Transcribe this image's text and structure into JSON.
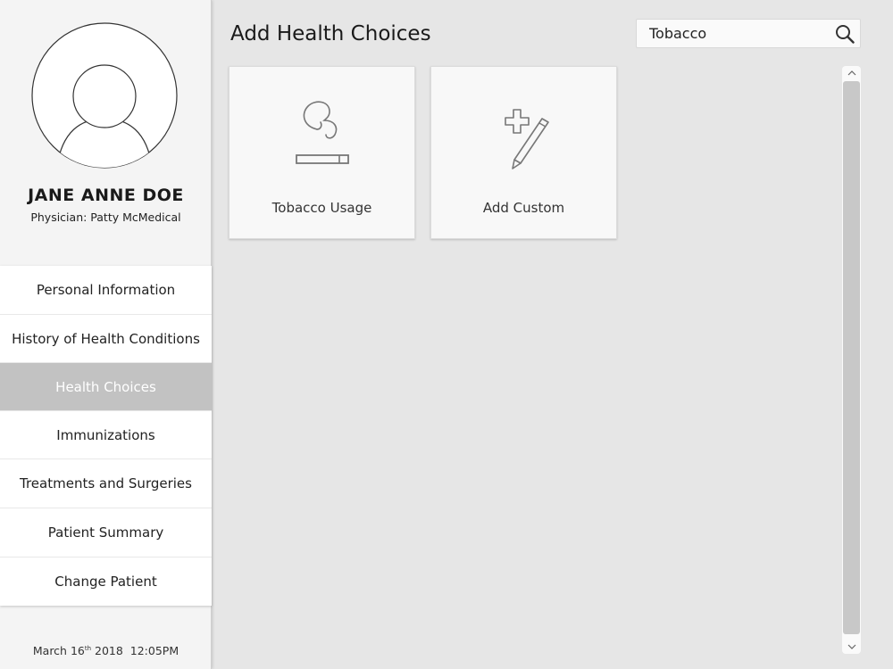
{
  "patient": {
    "name": "JANE ANNE DOE",
    "physician": "Physician: Patty McMedical"
  },
  "nav": {
    "items": [
      {
        "label": "Personal Information",
        "active": false
      },
      {
        "label": "History of Health Conditions",
        "active": false
      },
      {
        "label": "Health Choices",
        "active": true
      },
      {
        "label": "Immunizations",
        "active": false
      },
      {
        "label": "Treatments and Surgeries",
        "active": false
      },
      {
        "label": "Patient Summary",
        "active": false
      },
      {
        "label": "Change Patient",
        "active": false
      }
    ]
  },
  "datetime": {
    "month": "March 16",
    "day_suffix": "th",
    "year_time": " 2018  12:05PM"
  },
  "main": {
    "title": "Add Health Choices",
    "search": {
      "value": "Tobacco"
    },
    "cards": [
      {
        "label": "Tobacco Usage",
        "icon": "cigarette-smoke-icon"
      },
      {
        "label": "Add Custom",
        "icon": "plus-pencil-icon"
      }
    ]
  },
  "colors": {
    "background": "#e6e6e6",
    "active_nav": "#c2c2c2",
    "icon_stroke": "#777777"
  }
}
